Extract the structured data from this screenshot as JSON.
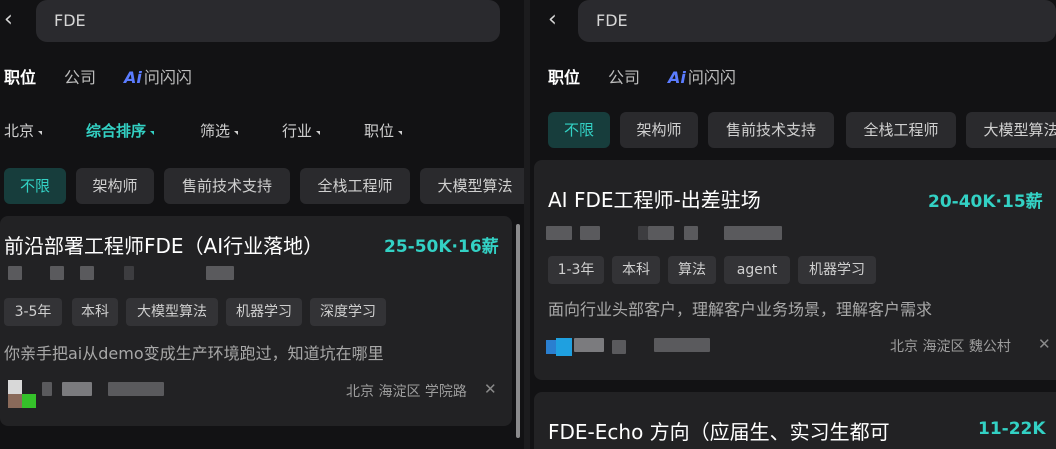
{
  "colors": {
    "accent": "#33d1c4",
    "ai_badge": "#5b7cff",
    "background": "#121214",
    "card": "#222224"
  },
  "icons": {
    "back": "chevron-left-icon",
    "close": "close-icon",
    "dropdown": "triangle-down-icon"
  },
  "left": {
    "back_glyph": "‹",
    "search": {
      "value": "FDE"
    },
    "tabs": [
      {
        "label": "职位"
      },
      {
        "label": "公司"
      },
      {
        "badge": "Ai",
        "label": "问闪闪"
      }
    ],
    "filters": [
      {
        "label": "北京"
      },
      {
        "label": "综合排序"
      },
      {
        "label": "筛选"
      },
      {
        "label": "行业"
      },
      {
        "label": "职位"
      }
    ],
    "chips": [
      {
        "label": "不限"
      },
      {
        "label": "架构师"
      },
      {
        "label": "售前技术支持"
      },
      {
        "label": "全栈工程师"
      },
      {
        "label": "大模型算法"
      }
    ],
    "job": {
      "title": "前沿部署工程师FDE（AI行业落地）",
      "salary": "25-50K·16薪",
      "tags": [
        "3-5年",
        "本科",
        "大模型算法",
        "机器学习",
        "深度学习"
      ],
      "description": "你亲手把ai从demo变成生产环境跑过，知道坑在哪里",
      "location": "北京  海淀区  学院路",
      "close": "✕"
    }
  },
  "right": {
    "back_glyph": "‹",
    "search": {
      "value": "FDE"
    },
    "tabs": [
      {
        "label": "职位"
      },
      {
        "label": "公司"
      },
      {
        "badge": "Ai",
        "label": "问闪闪"
      }
    ],
    "chips": [
      {
        "label": "不限"
      },
      {
        "label": "架构师"
      },
      {
        "label": "售前技术支持"
      },
      {
        "label": "全栈工程师"
      },
      {
        "label": "大模型算法"
      }
    ],
    "jobs": [
      {
        "title": "AI FDE工程师-出差驻场",
        "salary": "20-40K·15薪",
        "tags": [
          "1-3年",
          "本科",
          "算法",
          "agent",
          "机器学习"
        ],
        "description": "面向行业头部客户，理解客户业务场景，理解客户需求",
        "location": "北京  海淀区  魏公村",
        "close": "✕"
      },
      {
        "title": "FDE-Echo 方向（应届生、实习生都可",
        "salary": "11-22K"
      }
    ]
  }
}
